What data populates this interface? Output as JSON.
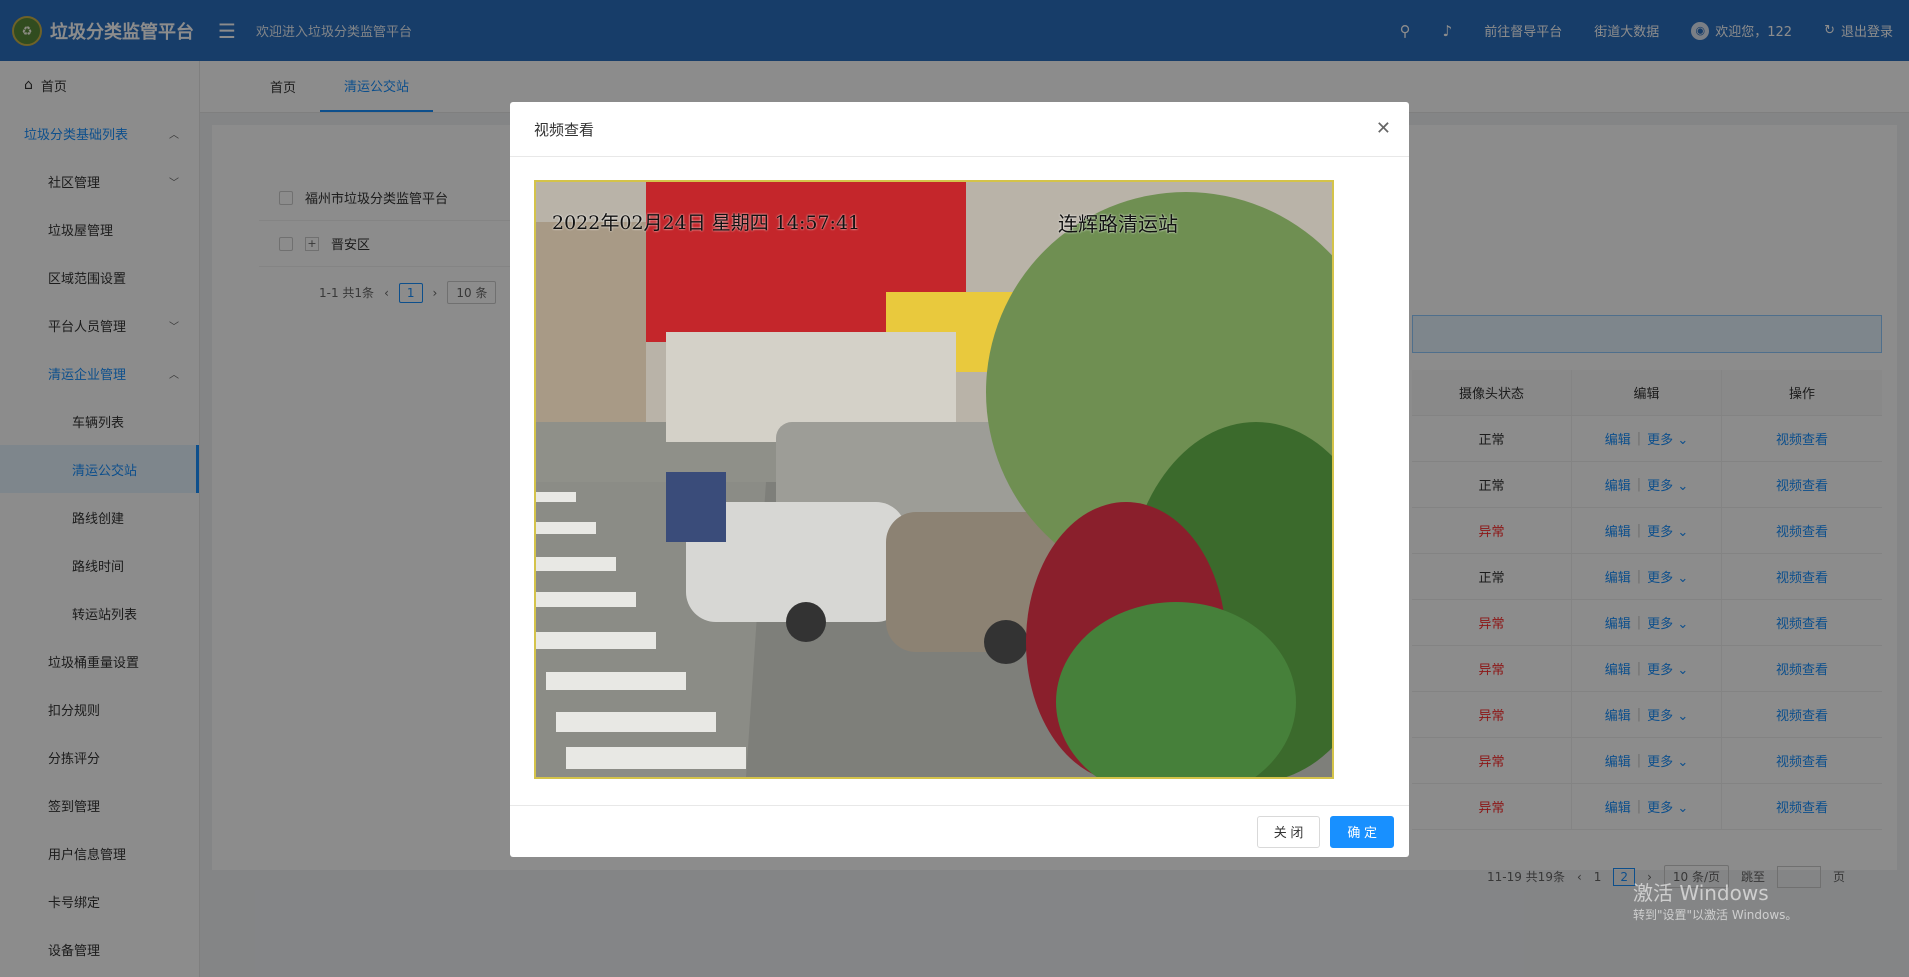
{
  "header": {
    "title": "垃圾分类监管平台",
    "welcome": "欢迎进入垃圾分类监管平台",
    "actions": {
      "search_icon": "search-icon",
      "bell_icon": "bell-icon",
      "guide": "前往督导平台",
      "bigdata": "街道大数据",
      "user": "欢迎您，122",
      "logout": "退出登录"
    }
  },
  "sidebar": {
    "items": [
      {
        "label": "首页"
      },
      {
        "label": "垃圾分类基础列表"
      },
      {
        "label": "社区管理"
      },
      {
        "label": "垃圾屋管理"
      },
      {
        "label": "区域范围设置"
      },
      {
        "label": "平台人员管理"
      },
      {
        "label": "清运企业管理"
      },
      {
        "label": "车辆列表"
      },
      {
        "label": "清运公交站"
      },
      {
        "label": "路线创建"
      },
      {
        "label": "路线时间"
      },
      {
        "label": "转运站列表"
      },
      {
        "label": "垃圾桶重量设置"
      },
      {
        "label": "扣分规则"
      },
      {
        "label": "分拣评分"
      },
      {
        "label": "签到管理"
      },
      {
        "label": "用户信息管理"
      },
      {
        "label": "卡号绑定"
      },
      {
        "label": "设备管理"
      }
    ]
  },
  "tabs": [
    {
      "label": "首页"
    },
    {
      "label": "清运公交站"
    }
  ],
  "tree": {
    "root": "福州市垃圾分类监管平台",
    "child": "晋安区",
    "pager_total": "1-1 共1条",
    "pager_page": "1",
    "pager_size": "10 条"
  },
  "table": {
    "headers": [
      "摄像头状态",
      "编辑",
      "操作"
    ],
    "edit_label": "编辑",
    "more_label": "更多",
    "view_label": "视频查看",
    "rows": [
      {
        "status": "正常"
      },
      {
        "status": "正常"
      },
      {
        "status": "异常"
      },
      {
        "status": "正常"
      },
      {
        "status": "异常"
      },
      {
        "status": "异常"
      },
      {
        "status": "异常"
      },
      {
        "status": "异常"
      },
      {
        "status": "异常"
      }
    ]
  },
  "pager": {
    "total": "11-19 共19条",
    "page1": "1",
    "page2": "2",
    "size": "10 条/页",
    "jump": "跳至",
    "page_unit": "页"
  },
  "modal": {
    "title": "视频查看",
    "video_timestamp": "2022年02月24日  星期四  14:57:41",
    "video_location": "连辉路清运站",
    "close_label": "关 闭",
    "confirm_label": "确 定"
  },
  "watermark": {
    "line1": "激活 Windows",
    "line2": "转到\"设置\"以激活 Windows。"
  },
  "colors": {
    "header_blue": "#2a6fc0",
    "accent": "#1890ff",
    "abnormal": "#ff2a2a"
  }
}
